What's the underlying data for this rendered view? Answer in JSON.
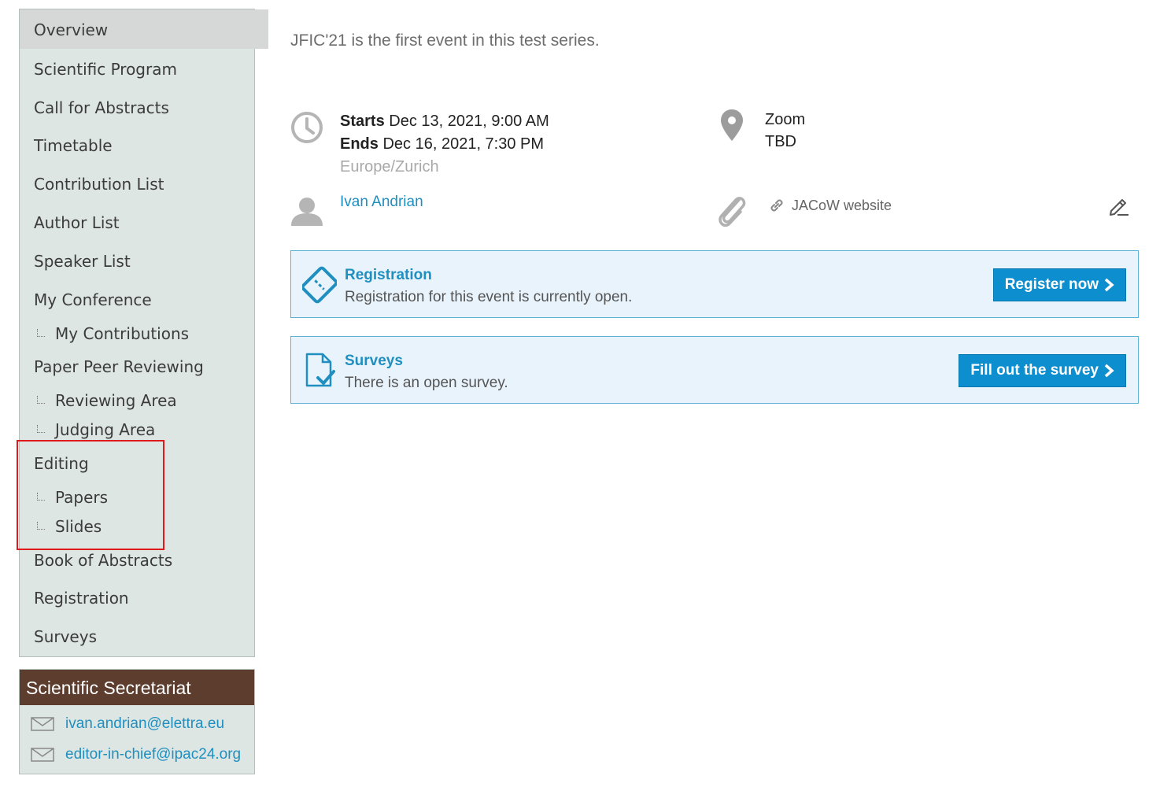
{
  "menu": {
    "items": [
      {
        "label": "Overview",
        "level": "top",
        "selected": true
      },
      {
        "label": "Scientific Program",
        "level": "top"
      },
      {
        "label": "Call for Abstracts",
        "level": "top"
      },
      {
        "label": "Timetable",
        "level": "top"
      },
      {
        "label": "Contribution List",
        "level": "top"
      },
      {
        "label": "Author List",
        "level": "top"
      },
      {
        "label": "Speaker List",
        "level": "top"
      },
      {
        "label": "My Conference",
        "level": "top"
      },
      {
        "label": "My Contributions",
        "level": "sub"
      },
      {
        "label": "Paper Peer Reviewing",
        "level": "top"
      },
      {
        "label": "Reviewing Area",
        "level": "sub"
      },
      {
        "label": "Judging Area",
        "level": "sub"
      },
      {
        "label": "Editing",
        "level": "top"
      },
      {
        "label": "Papers",
        "level": "sub"
      },
      {
        "label": "Slides",
        "level": "sub"
      },
      {
        "label": "Book of Abstracts",
        "level": "top"
      },
      {
        "label": "Registration",
        "level": "top"
      },
      {
        "label": "Surveys",
        "level": "top"
      }
    ]
  },
  "secretariat": {
    "title": "Scientific Secretariat",
    "emails": [
      "ivan.andrian@elettra.eu",
      "editor-in-chief@ipac24.org"
    ]
  },
  "event": {
    "intro": "JFIC'21 is the first event in this test series.",
    "starts_label": "Starts",
    "starts_value": "Dec 13, 2021, 9:00 AM",
    "ends_label": "Ends",
    "ends_value": "Dec 16, 2021, 7:30 PM",
    "timezone": "Europe/Zurich",
    "location_name": "Zoom",
    "location_address": "TBD",
    "chair": "Ivan Andrian",
    "link_label": "JACoW website"
  },
  "registration": {
    "title": "Registration",
    "subtitle": "Registration for this event is currently open.",
    "button": "Register now"
  },
  "surveys": {
    "title": "Surveys",
    "subtitle": "There is an open survey.",
    "button": "Fill out the survey"
  },
  "colors": {
    "link": "#1f8fc0",
    "button": "#0d8ecf",
    "sidebar_bg": "#dde6e3",
    "secretariat_header": "#5d3e2e",
    "highlight": "#e0191c"
  }
}
